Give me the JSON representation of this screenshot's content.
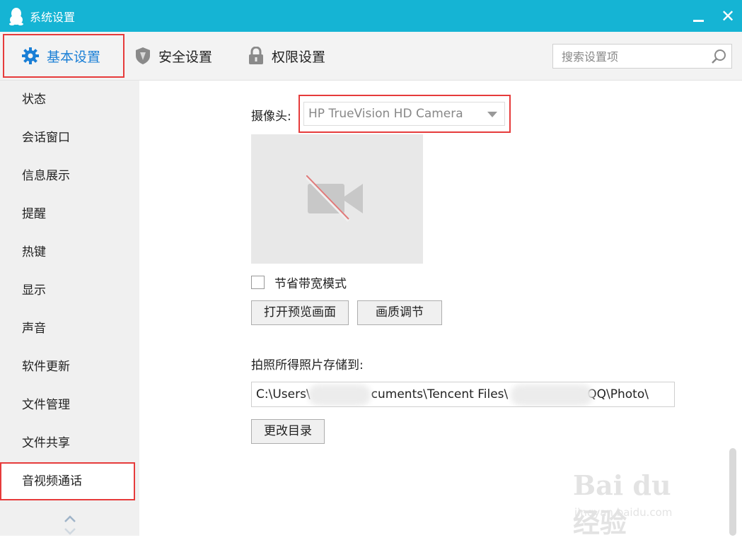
{
  "window": {
    "title": "系统设置",
    "close": "✕"
  },
  "tabs": [
    {
      "label": "基本设置"
    },
    {
      "label": "安全设置"
    },
    {
      "label": "权限设置"
    }
  ],
  "search": {
    "placeholder": "搜索设置项"
  },
  "sidebar": {
    "items": [
      {
        "label": "状态"
      },
      {
        "label": "会话窗口"
      },
      {
        "label": "信息展示"
      },
      {
        "label": "提醒"
      },
      {
        "label": "热键"
      },
      {
        "label": "显示"
      },
      {
        "label": "声音"
      },
      {
        "label": "软件更新"
      },
      {
        "label": "文件管理"
      },
      {
        "label": "文件共享"
      },
      {
        "label": "音视频通话"
      }
    ]
  },
  "camera": {
    "label": "摄像头:",
    "selected": "HP TrueVision HD Camera"
  },
  "bandwidth": {
    "label": "节省带宽模式",
    "checked": false
  },
  "buttons": {
    "preview": "打开预览画面",
    "quality": "画质调节",
    "change_dir": "更改目录"
  },
  "photo": {
    "label": "拍照所得照片存储到:",
    "path_seg1": "C:\\Users\\",
    "path_seg2": "cuments\\Tencent Files\\",
    "path_seg3": "QQ\\Photo\\"
  },
  "watermark": {
    "brand": "Bai du 经验",
    "url": "jingyan.baidu.com"
  },
  "colors": {
    "titlebar": "#15b4d4",
    "highlight": "#e63b3b",
    "active_tab": "#1a7fd6"
  }
}
